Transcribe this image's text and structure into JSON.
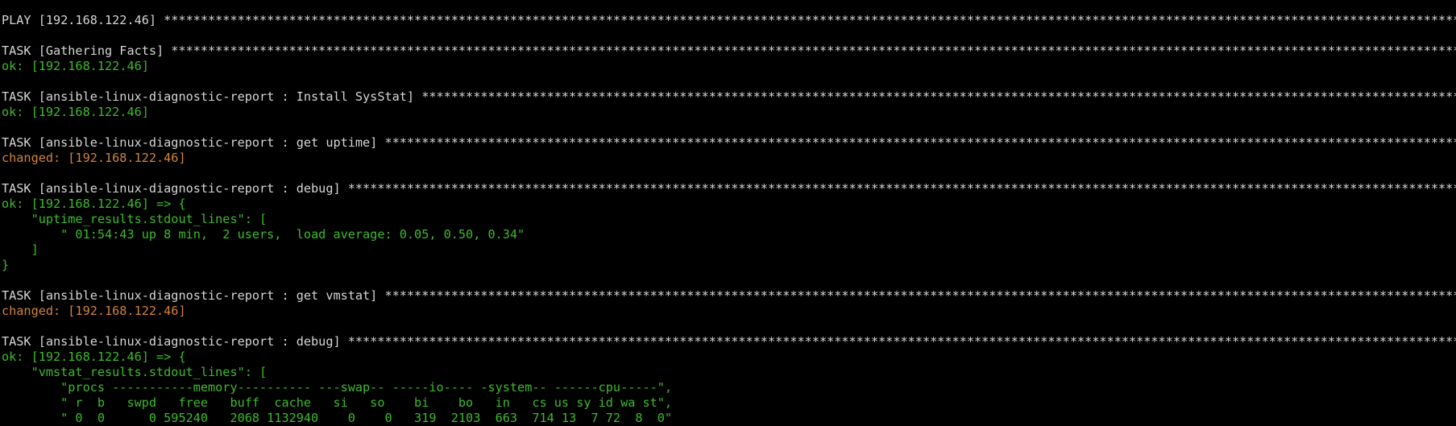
{
  "colors": {
    "background": "#000000",
    "white": "#d6d6d6",
    "ok": "#3dbb2a",
    "changed": "#d1833b"
  },
  "lines": [
    {
      "text": "PLAY [192.168.122.46] ***************************************************************************************************************************************************************************************************",
      "color": "white"
    },
    {
      "text": "",
      "color": "white"
    },
    {
      "text": "TASK [Gathering Facts] **************************************************************************************************************************************************************************************************",
      "color": "white"
    },
    {
      "text": "ok: [192.168.122.46]",
      "color": "green"
    },
    {
      "text": "",
      "color": "white"
    },
    {
      "text": "TASK [ansible-linux-diagnostic-report : Install SysStat] ****************************************************************************************************************************************************************",
      "color": "white"
    },
    {
      "text": "ok: [192.168.122.46]",
      "color": "green"
    },
    {
      "text": "",
      "color": "white"
    },
    {
      "text": "TASK [ansible-linux-diagnostic-report : get uptime] *********************************************************************************************************************************************************************",
      "color": "white"
    },
    {
      "text": "changed: [192.168.122.46]",
      "color": "orange"
    },
    {
      "text": "",
      "color": "white"
    },
    {
      "text": "TASK [ansible-linux-diagnostic-report : debug] **************************************************************************************************************************************************************************",
      "color": "white"
    },
    {
      "text": "ok: [192.168.122.46] => {",
      "color": "green"
    },
    {
      "text": "    \"uptime_results.stdout_lines\": [",
      "color": "green"
    },
    {
      "text": "        \" 01:54:43 up 8 min,  2 users,  load average: 0.05, 0.50, 0.34\"",
      "color": "green"
    },
    {
      "text": "    ]",
      "color": "green"
    },
    {
      "text": "}",
      "color": "green"
    },
    {
      "text": "",
      "color": "white"
    },
    {
      "text": "TASK [ansible-linux-diagnostic-report : get vmstat] *********************************************************************************************************************************************************************",
      "color": "white"
    },
    {
      "text": "changed: [192.168.122.46]",
      "color": "orange"
    },
    {
      "text": "",
      "color": "white"
    },
    {
      "text": "TASK [ansible-linux-diagnostic-report : debug] **************************************************************************************************************************************************************************",
      "color": "white"
    },
    {
      "text": "ok: [192.168.122.46] => {",
      "color": "green"
    },
    {
      "text": "    \"vmstat_results.stdout_lines\": [",
      "color": "green"
    },
    {
      "text": "        \"procs -----------memory---------- ---swap-- -----io---- -system-- ------cpu-----\",",
      "color": "green"
    },
    {
      "text": "        \" r  b   swpd   free   buff  cache   si   so    bi    bo   in   cs us sy id wa st\",",
      "color": "green"
    },
    {
      "text": "        \" 0  0      0 595240   2068 1132940    0    0   319  2103  663  714 13  7 72  8  0\"",
      "color": "green"
    }
  ]
}
